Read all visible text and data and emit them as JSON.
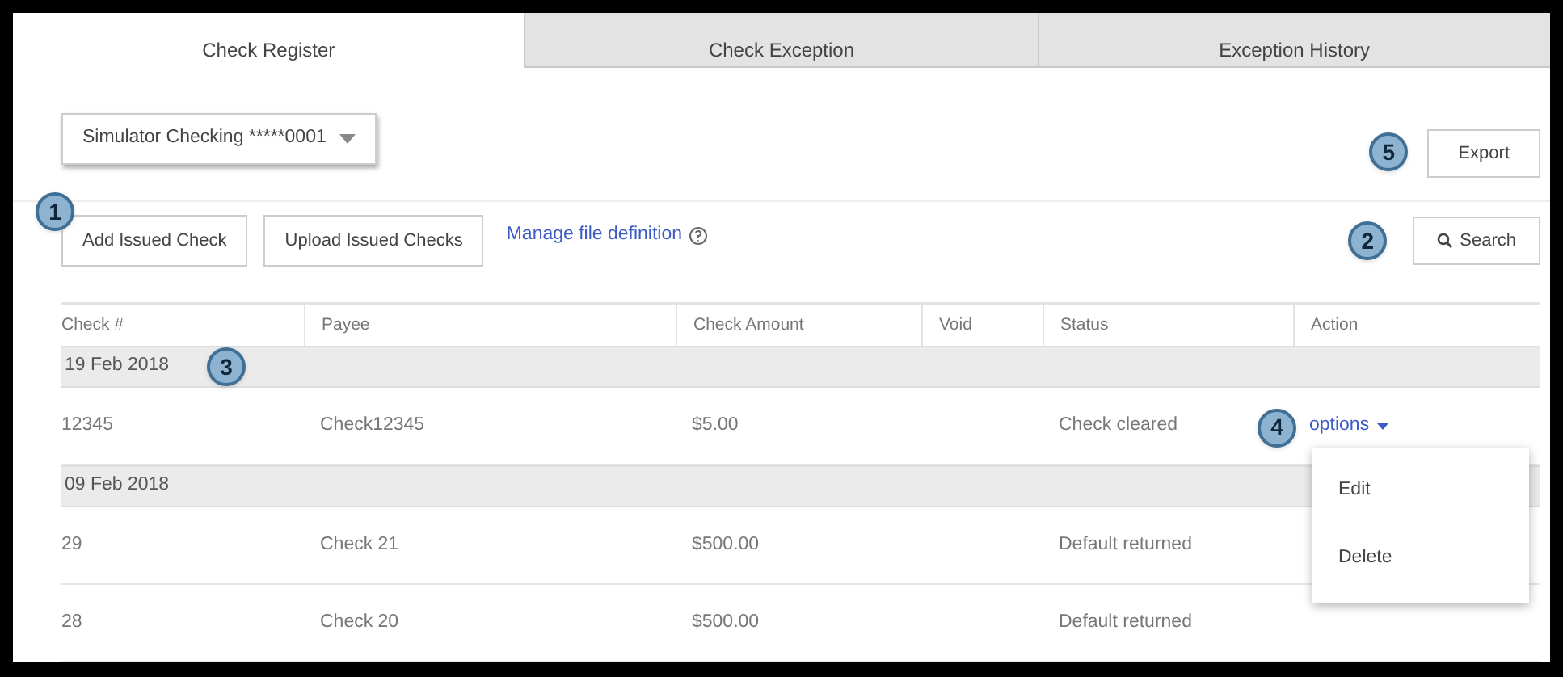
{
  "tabs": [
    {
      "label": "Check Register",
      "selected": true
    },
    {
      "label": "Check Exception",
      "selected": false
    },
    {
      "label": "Exception History",
      "selected": false
    }
  ],
  "account_select": {
    "value": "Simulator Checking *****0001"
  },
  "export_button": {
    "label": "Export",
    "callout": "5"
  },
  "toolbar": {
    "buttons": [
      {
        "label": "Add Issued Check",
        "callout": "1"
      },
      {
        "label": "Upload Issued Checks"
      }
    ],
    "link": "Manage file definition",
    "search_button": {
      "label": "Search",
      "callout": "2"
    }
  },
  "table": {
    "columns": [
      "Check #",
      "Payee",
      "Check Amount",
      "Void",
      "Status",
      "Action"
    ],
    "groups": [
      {
        "date": "19 Feb 2018",
        "callout": "3",
        "rows": [
          {
            "check": "12345",
            "payee": "Check12345",
            "amount": "$5.00",
            "void": "",
            "status": "Check cleared",
            "action": "options",
            "callout": "4"
          }
        ]
      },
      {
        "date": "09 Feb 2018",
        "rows": [
          {
            "check": "29",
            "payee": "Check 21",
            "amount": "$500.00",
            "status": "Default returned"
          },
          {
            "check": "28",
            "payee": "Check 20",
            "amount": "$500.00",
            "status": "Default returned"
          }
        ]
      }
    ]
  },
  "options_menu": {
    "items": [
      "Edit",
      "Delete"
    ]
  }
}
